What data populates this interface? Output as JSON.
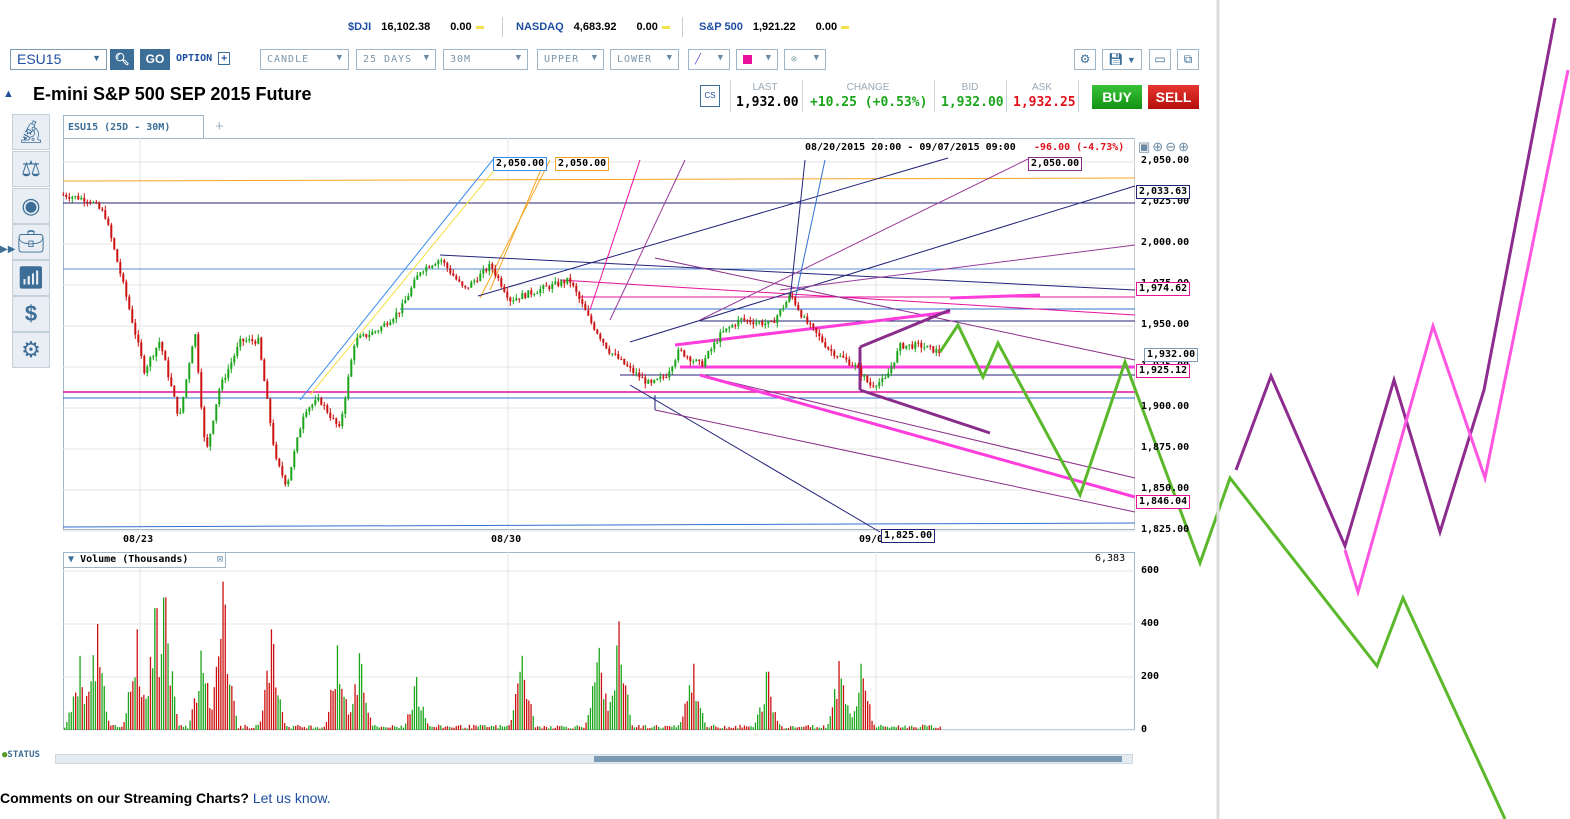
{
  "ticker": {
    "items": [
      {
        "symbol": "$DJI",
        "value": "16,102.38",
        "change": "0.00"
      },
      {
        "symbol": "NASDAQ",
        "value": "4,683.92",
        "change": "0.00"
      },
      {
        "symbol": "S&P 500",
        "value": "1,921.22",
        "change": "0.00"
      }
    ]
  },
  "toolbar": {
    "symbol": "ESU15",
    "search_icon": "magnifier-icon",
    "go_label": "GO",
    "option_label": "OPTION",
    "chart_type": "CANDLE",
    "range": "25 DAYS",
    "interval": "30M",
    "upper": "UPPER",
    "lower": "LOWER",
    "draw_color": "#e9119b"
  },
  "header": {
    "title": "E-mini S&P 500 SEP 2015 Future",
    "cs_label": "CS",
    "last_label": "LAST",
    "last": "1,932.00",
    "change_label": "CHANGE",
    "change": "+10.25 (+0.53%)",
    "bid_label": "BID",
    "bid": "1,932.00",
    "ask_label": "ASK",
    "ask": "1,932.25",
    "buy_label": "BUY",
    "sell_label": "SELL"
  },
  "chart_tab": {
    "label": "ESU15 (25D - 30M)",
    "add_label": "+"
  },
  "range_info": {
    "period": "08/20/2015 20:00 - 09/07/2015 09:00",
    "change": "-96.00 (-4.73%)"
  },
  "sidebar": {
    "icons": [
      "microscope-icon",
      "balance-scale-icon",
      "eye-icon",
      "briefcase-icon",
      "bar-chart-icon",
      "dollar-icon",
      "gear-icon"
    ]
  },
  "chart_data": {
    "type": "candlestick",
    "y_ticks": [
      "2,050.00",
      "2,025.00",
      "2,000.00",
      "1,975.00",
      "1,950.00",
      "1,925.00",
      "1,900.00",
      "1,875.00",
      "1,850.00",
      "1,825.00"
    ],
    "ylim": [
      1825,
      2050
    ],
    "x_ticks": [
      "08/23",
      "08/30",
      "09/06"
    ],
    "price_path": [
      [
        "08/21 13:00",
        2030
      ],
      [
        "08/22 01:00",
        2027
      ],
      [
        "08/22 08:00",
        2018
      ],
      [
        "08/22 17:00",
        1972
      ],
      [
        "08/23 02:00",
        1923
      ],
      [
        "08/23 09:00",
        1941
      ],
      [
        "08/23 18:00",
        1893
      ],
      [
        "08/24 01:00",
        1948
      ],
      [
        "08/24 06:00",
        1871
      ],
      [
        "08/24 12:00",
        1911
      ],
      [
        "08/24 22:00",
        1941
      ],
      [
        "08/25 06:00",
        1941
      ],
      [
        "08/25 14:00",
        1868
      ],
      [
        "08/25 19:00",
        1853
      ],
      [
        "08/26 03:00",
        1899
      ],
      [
        "08/26 10:00",
        1905
      ],
      [
        "08/26 19:00",
        1887
      ],
      [
        "08/27 02:00",
        1941
      ],
      [
        "08/27 13:00",
        1948
      ],
      [
        "08/27 23:00",
        1960
      ],
      [
        "08/28 08:00",
        1984
      ],
      [
        "08/28 17:00",
        1991
      ],
      [
        "08/29 04:00",
        1972
      ],
      [
        "08/29 16:00",
        1987
      ],
      [
        "08/30 01:00",
        1966
      ],
      [
        "08/30 14:00",
        1972
      ],
      [
        "08/31 04:00",
        1978
      ],
      [
        "08/31 13:00",
        1954
      ],
      [
        "08/31 22:00",
        1935
      ],
      [
        "09/01 08:00",
        1923
      ],
      [
        "09/01 17:00",
        1914
      ],
      [
        "09/02 00:00",
        1920
      ],
      [
        "09/02 06:00",
        1935
      ],
      [
        "09/02 16:00",
        1926
      ],
      [
        "09/03 01:00",
        1945
      ],
      [
        "09/03 10:00",
        1954
      ],
      [
        "09/04 00:00",
        1951
      ],
      [
        "09/04 09:00",
        1969
      ],
      [
        "09/04 15:00",
        1954
      ],
      [
        "09/05 03:00",
        1935
      ],
      [
        "09/05 14:00",
        1926
      ],
      [
        "09/05 21:00",
        1914
      ],
      [
        "09/06 04:00",
        1917
      ],
      [
        "09/06 11:00",
        1938
      ],
      [
        "09/06 20:00",
        1938
      ],
      [
        "09/07 05:00",
        1934
      ]
    ],
    "price_labels": {
      "top_boxes": [
        "2,050.00",
        "2,050.00",
        "2,050.00"
      ],
      "r_2033": "2,033.63",
      "r_1974": "1,974.62",
      "r_last": "1,932.00",
      "r_1925": "1,925.12",
      "r_1846": "1,846.04",
      "bottom_box": "1,825.00"
    },
    "volume": {
      "title": "Volume (Thousands)",
      "last": "6,383",
      "y_ticks": [
        "600",
        "400",
        "200",
        "0"
      ],
      "ylim": [
        0,
        600
      ],
      "peaks": [
        [
          "08/21 20:00",
          280
        ],
        [
          "08/22 04:00",
          400
        ],
        [
          "08/22 22:00",
          380
        ],
        [
          "08/23 07:00",
          460
        ],
        [
          "08/23 11:00",
          500
        ],
        [
          "08/24 04:00",
          300
        ],
        [
          "08/24 14:00",
          560
        ],
        [
          "08/25 12:00",
          380
        ],
        [
          "08/26 18:00",
          320
        ],
        [
          "08/27 04:00",
          290
        ],
        [
          "08/28 06:00",
          200
        ],
        [
          "08/30 06:00",
          280
        ],
        [
          "08/31 17:00",
          310
        ],
        [
          "09/01 02:00",
          410
        ],
        [
          "09/02 12:00",
          250
        ],
        [
          "09/03 22:00",
          220
        ],
        [
          "09/05 07:00",
          260
        ],
        [
          "09/05 17:00",
          250
        ]
      ]
    },
    "colors": {
      "up": "#1aa51a",
      "down": "#cc1111"
    }
  },
  "status_label": "STATUS",
  "footer": {
    "question": "Comments on our Streaming Charts?",
    "link": "Let us know."
  }
}
